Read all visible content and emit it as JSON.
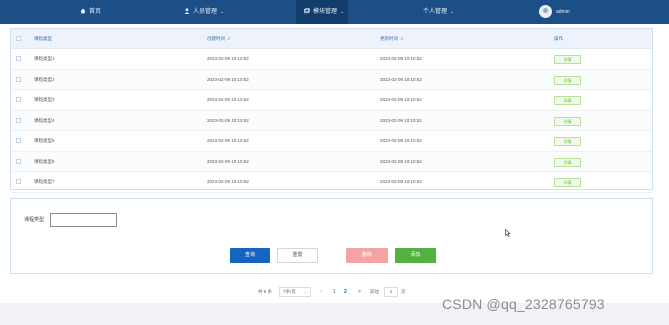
{
  "nav": {
    "home": "首页",
    "personnel": "人员管理",
    "modules": "模块管理",
    "personal": "个人管理",
    "user": "admin"
  },
  "table": {
    "headers": {
      "course_type": "课程类型",
      "created": "创建时间",
      "updated": "更新时间",
      "action": "操作"
    },
    "rows": [
      {
        "name": "课程类型1",
        "created": "2023-02-09 10:10:52",
        "updated": "2023-02-09 10:10:52",
        "action": "详情"
      },
      {
        "name": "课程类型2",
        "created": "2023-02-09 10:10:52",
        "updated": "2023-02-09 10:10:52",
        "action": "详情"
      },
      {
        "name": "课程类型3",
        "created": "2023-02-09 10:10:52",
        "updated": "2023-02-09 10:10:52",
        "action": "详情"
      },
      {
        "name": "课程类型4",
        "created": "2023-02-09 10:10:52",
        "updated": "2023-02-09 10:10:52",
        "action": "详情"
      },
      {
        "name": "课程类型5",
        "created": "2023-02-09 10:10:52",
        "updated": "2023-02-09 10:10:52",
        "action": "详情"
      },
      {
        "name": "课程类型6",
        "created": "2023-02-09 10:10:52",
        "updated": "2023-02-09 10:10:52",
        "action": "详情"
      },
      {
        "name": "课程类型7",
        "created": "2023-02-09 10:10:52",
        "updated": "2023-02-09 10:10:52",
        "action": "详情"
      }
    ]
  },
  "search": {
    "label": "课程类型",
    "value": "",
    "query_label": "查询",
    "reset_label": "重置",
    "delete_label": "删除",
    "add_label": "添加"
  },
  "pagination": {
    "total": "共 8 条",
    "page_size": "7条/页",
    "pages": [
      "1",
      "2"
    ],
    "current_page": "2",
    "goto_label": "前往",
    "goto_value": "1",
    "page_unit": "页"
  },
  "watermark": "CSDN @qq_2328765793",
  "colors": {
    "nav_bg": "#1b4f86",
    "accent": "#1565c0",
    "delete": "#f4a3a3",
    "add": "#52b13f"
  }
}
